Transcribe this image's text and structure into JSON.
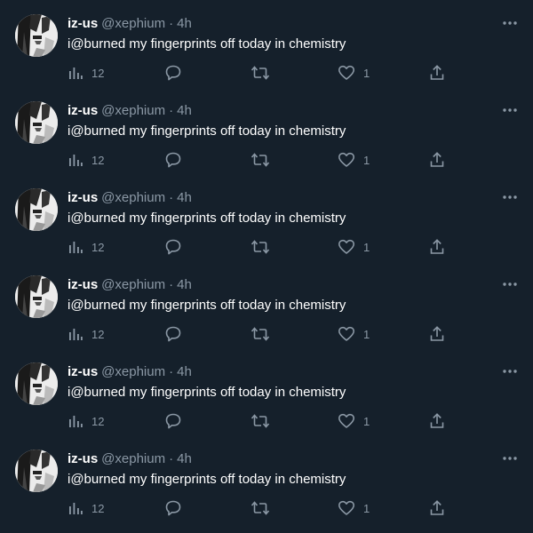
{
  "colors": {
    "background": "#15202b",
    "primary_text": "#e7e9ea",
    "secondary_text": "#8b98a5"
  },
  "icons": {
    "more": "more-horizontal-icon",
    "views": "views-bar-chart-icon",
    "reply": "reply-bubble-icon",
    "retweet": "retweet-icon",
    "like": "heart-icon",
    "share": "share-upload-icon"
  },
  "tweets": [
    {
      "name": "iz-us",
      "handle": "@xephium",
      "separator": "·",
      "time": "4h",
      "text": "i@burned my fingerprints off today in chemistry",
      "views": "12",
      "likes": "1"
    },
    {
      "name": "iz-us",
      "handle": "@xephium",
      "separator": "·",
      "time": "4h",
      "text": "i@burned my fingerprints off today in chemistry",
      "views": "12",
      "likes": "1"
    },
    {
      "name": "iz-us",
      "handle": "@xephium",
      "separator": "·",
      "time": "4h",
      "text": "i@burned my fingerprints off today in chemistry",
      "views": "12",
      "likes": "1"
    },
    {
      "name": "iz-us",
      "handle": "@xephium",
      "separator": "·",
      "time": "4h",
      "text": "i@burned my fingerprints off today in chemistry",
      "views": "12",
      "likes": "1"
    },
    {
      "name": "iz-us",
      "handle": "@xephium",
      "separator": "·",
      "time": "4h",
      "text": "i@burned my fingerprints off today in chemistry",
      "views": "12",
      "likes": "1"
    },
    {
      "name": "iz-us",
      "handle": "@xephium",
      "separator": "·",
      "time": "4h",
      "text": "i@burned my fingerprints off today in chemistry",
      "views": "12",
      "likes": "1"
    }
  ]
}
